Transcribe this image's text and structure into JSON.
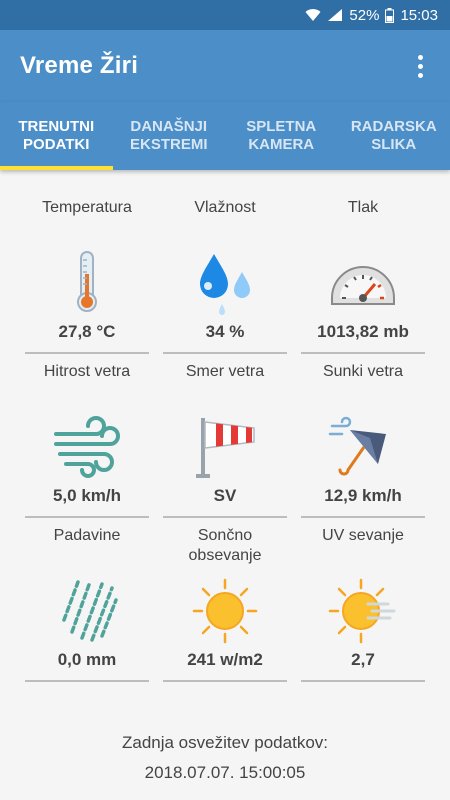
{
  "status_bar": {
    "battery": "52%",
    "time": "15:03"
  },
  "app_bar": {
    "title": "Vreme Žiri",
    "menu_icon": "more-vert-icon"
  },
  "tabs": [
    {
      "label": "TRENUTNI\nPODATKI",
      "active": true
    },
    {
      "label": "DANAŠNJI\nEKSTREMI",
      "active": false
    },
    {
      "label": "SPLETNA\nKAMERA",
      "active": false
    },
    {
      "label": "RADARSKA\nSLIKA",
      "active": false
    }
  ],
  "measurements": [
    {
      "label": "Temperatura",
      "value": "27,8 °C",
      "icon": "thermometer-icon"
    },
    {
      "label": "Vlažnost",
      "value": "34 %",
      "icon": "water-drops-icon"
    },
    {
      "label": "Tlak",
      "value": "1013,82 mb",
      "icon": "gauge-icon"
    },
    {
      "label": "Hitrost vetra",
      "value": "5,0 km/h",
      "icon": "wind-icon"
    },
    {
      "label": "Smer vetra",
      "value": "SV",
      "icon": "windsock-icon"
    },
    {
      "label": "Sunki vetra",
      "value": "12,9 km/h",
      "icon": "windy-umbrella-icon"
    },
    {
      "label": "Padavine",
      "value": "0,0 mm",
      "icon": "rain-icon"
    },
    {
      "label": "Sončno\nobsevanje",
      "value": "241 w/m2",
      "icon": "sun-icon"
    },
    {
      "label": "UV sevanje",
      "value": "2,7",
      "icon": "uv-sun-icon"
    }
  ],
  "footer": {
    "line1": "Zadnja osvežitev podatkov:",
    "line2": "2018.07.07. 15:00:05"
  },
  "colors": {
    "status_bar": "#2f6fa6",
    "app_bar": "#4b8ec8",
    "tab_indicator": "#ffe033",
    "background": "#f5f5f5"
  }
}
